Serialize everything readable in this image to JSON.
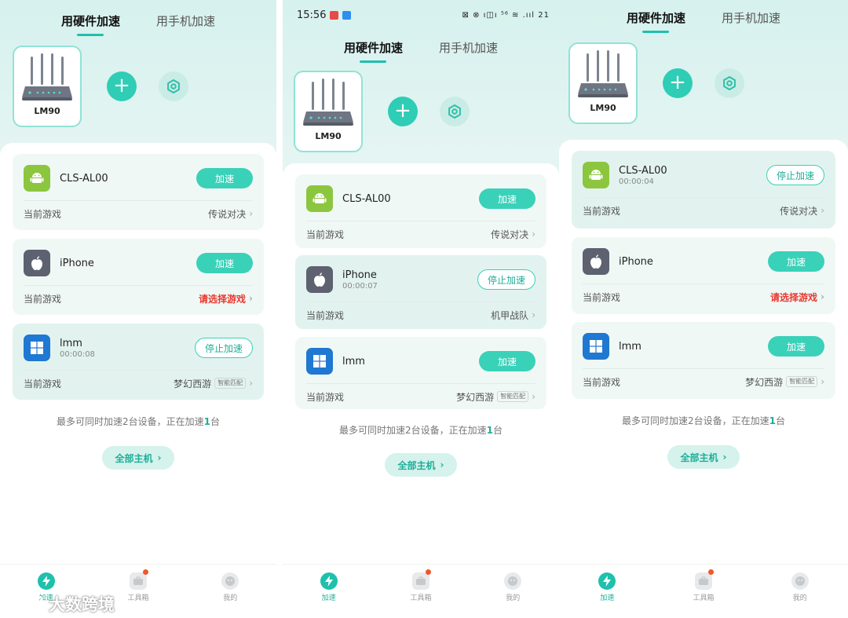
{
  "colors": {
    "accent": "#2fcdb5",
    "danger": "#e8392f",
    "android": "#8cc63e",
    "apple": "#5d6170",
    "windows": "#1f78d1"
  },
  "panels": [
    {
      "status_time": "",
      "tabs": [
        "用硬件加速",
        "用手机加速"
      ],
      "router_name": "LM90",
      "devices": [
        {
          "os": "android",
          "name": "CLS-AL00",
          "timer": "",
          "button": "加速",
          "active": false,
          "game_label": "当前游戏",
          "game": "传说对决",
          "game_red": false,
          "tag": ""
        },
        {
          "os": "apple",
          "name": "iPhone",
          "timer": "",
          "button": "加速",
          "active": false,
          "game_label": "当前游戏",
          "game": "请选择游戏",
          "game_red": true,
          "tag": ""
        },
        {
          "os": "win",
          "name": "lmm",
          "timer": "00:00:08",
          "button": "停止加速",
          "active": true,
          "game_label": "当前游戏",
          "game": "梦幻西游",
          "game_red": false,
          "tag": "智能匹配"
        }
      ],
      "limit_prefix": "最多可同时加速2台设备，正在加速",
      "limit_count": "1",
      "limit_suffix": "台",
      "all_hosts": "全部主机"
    },
    {
      "status_time": "15:56",
      "status_right": "⊠ ⊗ ı◫ı ⁵⁶ ≋ .ııl 21",
      "tabs": [
        "用硬件加速",
        "用手机加速"
      ],
      "router_name": "LM90",
      "devices": [
        {
          "os": "android",
          "name": "CLS-AL00",
          "timer": "",
          "button": "加速",
          "active": false,
          "game_label": "当前游戏",
          "game": "传说对决",
          "game_red": false,
          "tag": ""
        },
        {
          "os": "apple",
          "name": "iPhone",
          "timer": "00:00:07",
          "button": "停止加速",
          "active": true,
          "game_label": "当前游戏",
          "game": "机甲战队",
          "game_red": false,
          "tag": ""
        },
        {
          "os": "win",
          "name": "lmm",
          "timer": "",
          "button": "加速",
          "active": false,
          "game_label": "当前游戏",
          "game": "梦幻西游",
          "game_red": false,
          "tag": "智能匹配"
        }
      ],
      "limit_prefix": "最多可同时加速2台设备，正在加速",
      "limit_count": "1",
      "limit_suffix": "台",
      "all_hosts": "全部主机"
    },
    {
      "status_time": "",
      "tabs": [
        "用硬件加速",
        "用手机加速"
      ],
      "router_name": "LM90",
      "devices": [
        {
          "os": "android",
          "name": "CLS-AL00",
          "timer": "00:00:04",
          "button": "停止加速",
          "active": true,
          "game_label": "当前游戏",
          "game": "传说对决",
          "game_red": false,
          "tag": ""
        },
        {
          "os": "apple",
          "name": "iPhone",
          "timer": "",
          "button": "加速",
          "active": false,
          "game_label": "当前游戏",
          "game": "请选择游戏",
          "game_red": true,
          "tag": ""
        },
        {
          "os": "win",
          "name": "lmm",
          "timer": "",
          "button": "加速",
          "active": false,
          "game_label": "当前游戏",
          "game": "梦幻西游",
          "game_red": false,
          "tag": "智能匹配"
        }
      ],
      "limit_prefix": "最多可同时加速2台设备，正在加速",
      "limit_count": "1",
      "limit_suffix": "台",
      "all_hosts": "全部主机"
    }
  ],
  "nav": {
    "items": [
      {
        "label": "加速",
        "icon": "lightning-icon"
      },
      {
        "label": "工具箱",
        "icon": "toolbox-icon"
      },
      {
        "label": "我的",
        "icon": "profile-icon"
      }
    ]
  },
  "watermark": "大数跨境"
}
